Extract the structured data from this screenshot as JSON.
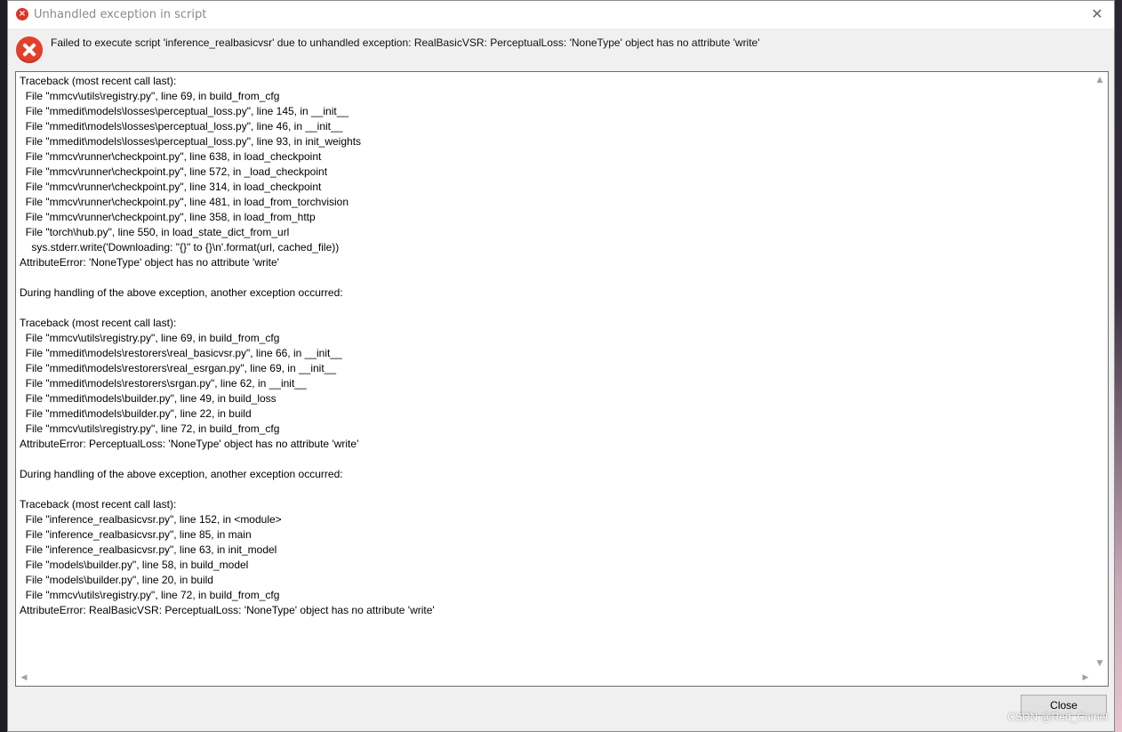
{
  "dialog": {
    "title": "Unhandled exception in script",
    "close_glyph": "✕",
    "title_icon": "error-small-icon",
    "message": "Failed to execute script 'inference_realbasicvsr' due to unhandled exception: RealBasicVSR: PerceptualLoss: 'NoneType' object has no attribute 'write'",
    "message_icon": "error-icon",
    "traceback": [
      "Traceback (most recent call last):",
      "  File \"mmcv\\utils\\registry.py\", line 69, in build_from_cfg",
      "  File \"mmedit\\models\\losses\\perceptual_loss.py\", line 145, in __init__",
      "  File \"mmedit\\models\\losses\\perceptual_loss.py\", line 46, in __init__",
      "  File \"mmedit\\models\\losses\\perceptual_loss.py\", line 93, in init_weights",
      "  File \"mmcv\\runner\\checkpoint.py\", line 638, in load_checkpoint",
      "  File \"mmcv\\runner\\checkpoint.py\", line 572, in _load_checkpoint",
      "  File \"mmcv\\runner\\checkpoint.py\", line 314, in load_checkpoint",
      "  File \"mmcv\\runner\\checkpoint.py\", line 481, in load_from_torchvision",
      "  File \"mmcv\\runner\\checkpoint.py\", line 358, in load_from_http",
      "  File \"torch\\hub.py\", line 550, in load_state_dict_from_url",
      "    sys.stderr.write('Downloading: \"{}\" to {}\\n'.format(url, cached_file))",
      "AttributeError: 'NoneType' object has no attribute 'write'",
      "",
      "During handling of the above exception, another exception occurred:",
      "",
      "Traceback (most recent call last):",
      "  File \"mmcv\\utils\\registry.py\", line 69, in build_from_cfg",
      "  File \"mmedit\\models\\restorers\\real_basicvsr.py\", line 66, in __init__",
      "  File \"mmedit\\models\\restorers\\real_esrgan.py\", line 69, in __init__",
      "  File \"mmedit\\models\\restorers\\srgan.py\", line 62, in __init__",
      "  File \"mmedit\\models\\builder.py\", line 49, in build_loss",
      "  File \"mmedit\\models\\builder.py\", line 22, in build",
      "  File \"mmcv\\utils\\registry.py\", line 72, in build_from_cfg",
      "AttributeError: PerceptualLoss: 'NoneType' object has no attribute 'write'",
      "",
      "During handling of the above exception, another exception occurred:",
      "",
      "Traceback (most recent call last):",
      "  File \"inference_realbasicvsr.py\", line 152, in <module>",
      "  File \"inference_realbasicvsr.py\", line 85, in main",
      "  File \"inference_realbasicvsr.py\", line 63, in init_model",
      "  File \"models\\builder.py\", line 58, in build_model",
      "  File \"models\\builder.py\", line 20, in build",
      "  File \"mmcv\\utils\\registry.py\", line 72, in build_from_cfg",
      "AttributeError: RealBasicVSR: PerceptualLoss: 'NoneType' object has no attribute 'write'"
    ],
    "close_button_label": "Close"
  },
  "scrollbar": {
    "up_glyph": "▲",
    "down_glyph": "▼",
    "left_glyph": "◀",
    "right_glyph": "▶"
  },
  "watermark": "CSDN @Red_Camel",
  "colors": {
    "error_red": "#e43f2c",
    "dialog_bg": "#f0f0f0",
    "button_bg": "#e1e1e1"
  }
}
